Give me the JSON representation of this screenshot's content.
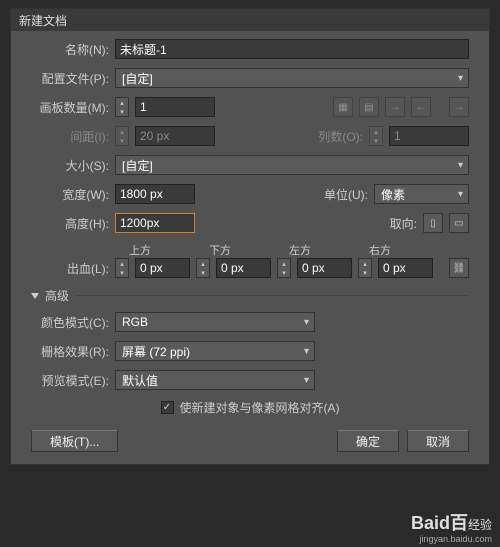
{
  "title": "新建文档",
  "name": {
    "label": "名称(N):",
    "value": "未标题-1"
  },
  "profile": {
    "label": "配置文件(P):",
    "value": "[自定]"
  },
  "artboards": {
    "label": "画板数量(M):",
    "value": "1"
  },
  "spacing": {
    "label": "间距(I):",
    "value": "20 px"
  },
  "cols": {
    "label": "列数(O):",
    "value": "1"
  },
  "size": {
    "label": "大小(S):",
    "value": "[自定]"
  },
  "width": {
    "label": "宽度(W):",
    "value": "1800 px"
  },
  "height": {
    "label": "高度(H):",
    "value": "1200px"
  },
  "units": {
    "label": "单位(U):",
    "value": "像素"
  },
  "orient": {
    "label": "取向:"
  },
  "bleed": {
    "label": "出血(L):",
    "top": {
      "label": "上方",
      "value": "0 px"
    },
    "bottom": {
      "label": "下方",
      "value": "0 px"
    },
    "left": {
      "label": "左方",
      "value": "0 px"
    },
    "right": {
      "label": "右方",
      "value": "0 px"
    }
  },
  "advanced": {
    "label": "高级"
  },
  "colorMode": {
    "label": "颜色模式(C):",
    "value": "RGB"
  },
  "raster": {
    "label": "栅格效果(R):",
    "value": "屏幕 (72 ppi)"
  },
  "preview": {
    "label": "预览模式(E):",
    "value": "默认值"
  },
  "align": {
    "label": "使新建对象与像素网格对齐(A)"
  },
  "buttons": {
    "template": "模板(T)...",
    "ok": "确定",
    "cancel": "取消"
  },
  "watermark": {
    "brand": "Baid百",
    "sub": "经验",
    "url": "jingyan.baidu.com"
  }
}
